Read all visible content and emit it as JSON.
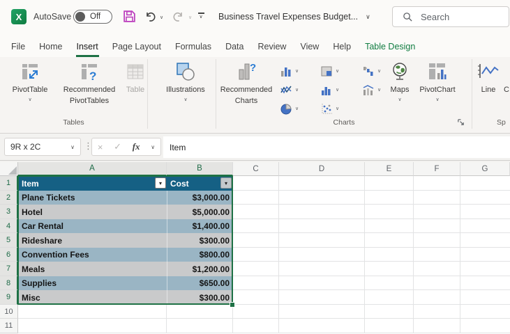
{
  "icons": {
    "excel_logo": "X",
    "chevron": "∨",
    "dropdown": "▾",
    "cancel": "×",
    "check": "✓",
    "dots": "⋮"
  },
  "titlebar": {
    "autosave_label": "AutoSave",
    "autosave_state": "Off",
    "document_title": "Business Travel Expenses Budget...",
    "search_placeholder": "Search"
  },
  "menu": {
    "tabs": [
      "File",
      "Home",
      "Insert",
      "Page Layout",
      "Formulas",
      "Data",
      "Review",
      "View",
      "Help"
    ],
    "active_tab": "Insert",
    "contextual_tab": "Table Design"
  },
  "ribbon": {
    "tables": {
      "group_label": "Tables",
      "pivottable_label": "PivotTable",
      "recommended_line1": "Recommended",
      "recommended_line2": "PivotTables",
      "table_label": "Table"
    },
    "illustrations": {
      "button_label": "Illustrations"
    },
    "charts": {
      "group_label": "Charts",
      "recommended_line1": "Recommended",
      "recommended_line2": "Charts",
      "maps_label": "Maps",
      "pivotchart_label": "PivotChart"
    },
    "sparklines": {
      "group_label_partial": "Sp",
      "line_label": "Line",
      "column_label_partial": "C"
    }
  },
  "formula_bar": {
    "name_box": "9R x 2C",
    "fx_label": "fx",
    "content": "Item"
  },
  "grid": {
    "columns": [
      "A",
      "B",
      "C",
      "D",
      "E",
      "F",
      "G"
    ],
    "row_numbers": [
      "1",
      "2",
      "3",
      "4",
      "5",
      "6",
      "7",
      "8",
      "9",
      "10",
      "11"
    ]
  },
  "table": {
    "headers": [
      "Item",
      "Cost"
    ],
    "rows": [
      {
        "item": "Plane Tickets",
        "cost": "$3,000.00"
      },
      {
        "item": "Hotel",
        "cost": "$5,000.00"
      },
      {
        "item": "Car Rental",
        "cost": "$1,400.00"
      },
      {
        "item": "Rideshare",
        "cost": "$300.00"
      },
      {
        "item": "Convention Fees",
        "cost": "$800.00"
      },
      {
        "item": "Meals",
        "cost": "$1,200.00"
      },
      {
        "item": "Supplies",
        "cost": "$650.00"
      },
      {
        "item": "Misc",
        "cost": "$300.00"
      }
    ]
  },
  "colors": {
    "excel_green": "#107C41",
    "selection_green": "#1E7145",
    "table_header_teal": "#156084",
    "band_blue": "#9AB5C4",
    "band_gray": "#C9CACB",
    "save_icon_magenta": "#BC3FBE"
  }
}
